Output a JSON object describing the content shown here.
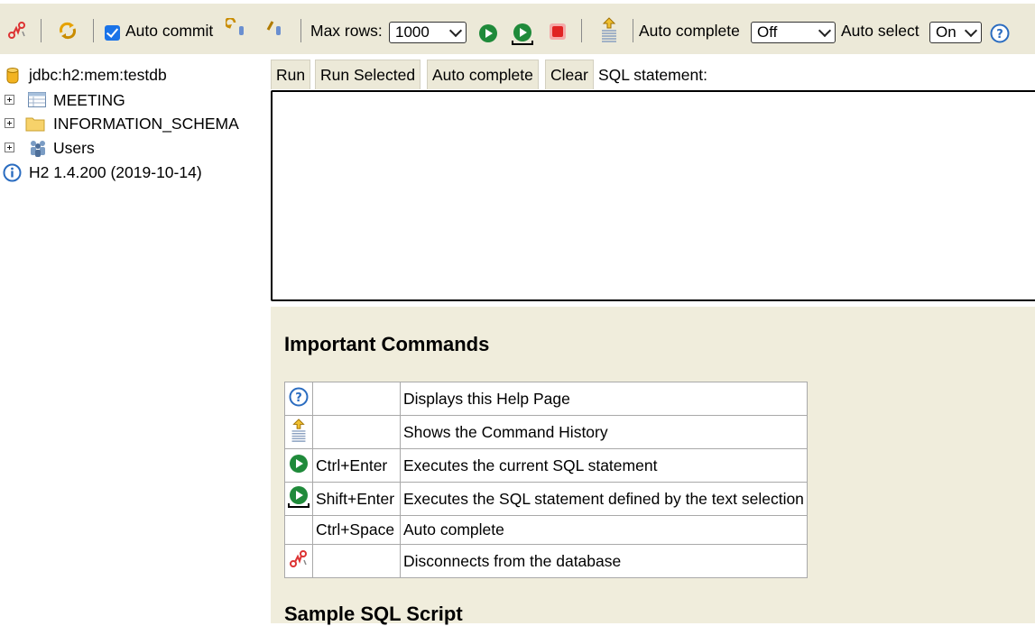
{
  "toolbar": {
    "auto_commit_label": "Auto commit",
    "max_rows_label": "Max rows:",
    "max_rows_value": "1000",
    "auto_complete_label": "Auto complete",
    "auto_complete_value": "Off",
    "auto_select_label": "Auto select",
    "auto_select_value": "On",
    "icons": [
      "disconnect-icon",
      "refresh-icon",
      "rollback-icon",
      "commit-icon",
      "run-icon",
      "run-selected-icon",
      "stop-icon",
      "history-icon",
      "help-icon"
    ]
  },
  "tree": {
    "connection": "jdbc:h2:mem:testdb",
    "items": [
      {
        "label": "MEETING",
        "icon": "table-icon"
      },
      {
        "label": "INFORMATION_SCHEMA",
        "icon": "folder-icon"
      },
      {
        "label": "Users",
        "icon": "users-icon"
      }
    ],
    "version": "H2 1.4.200 (2019-10-14)"
  },
  "sql": {
    "run_label": "Run",
    "run_selected_label": "Run Selected",
    "auto_complete_label": "Auto complete",
    "clear_label": "Clear",
    "statement_label": "SQL statement:",
    "statement_value": ""
  },
  "help": {
    "important_title": "Important Commands",
    "sample_title": "Sample SQL Script",
    "commands": [
      {
        "icon": "help-icon",
        "key": "",
        "description": "Displays this Help Page"
      },
      {
        "icon": "history-icon",
        "key": "",
        "description": "Shows the Command History"
      },
      {
        "icon": "run-icon",
        "key": "Ctrl+Enter",
        "description": "Executes the current SQL statement"
      },
      {
        "icon": "run-selected-icon",
        "key": "Shift+Enter",
        "description": "Executes the SQL statement defined by the text selection"
      },
      {
        "icon": "",
        "key": "Ctrl+Space",
        "description": "Auto complete"
      },
      {
        "icon": "disconnect-icon",
        "key": "",
        "description": "Disconnects from the database"
      }
    ]
  },
  "colors": {
    "toolbar_bg": "#ece9d8",
    "help_bg": "#f0eddc",
    "run_green": "#1f8a3a",
    "stop_red": "#e02424",
    "checkbox_blue": "#1a73e8"
  }
}
